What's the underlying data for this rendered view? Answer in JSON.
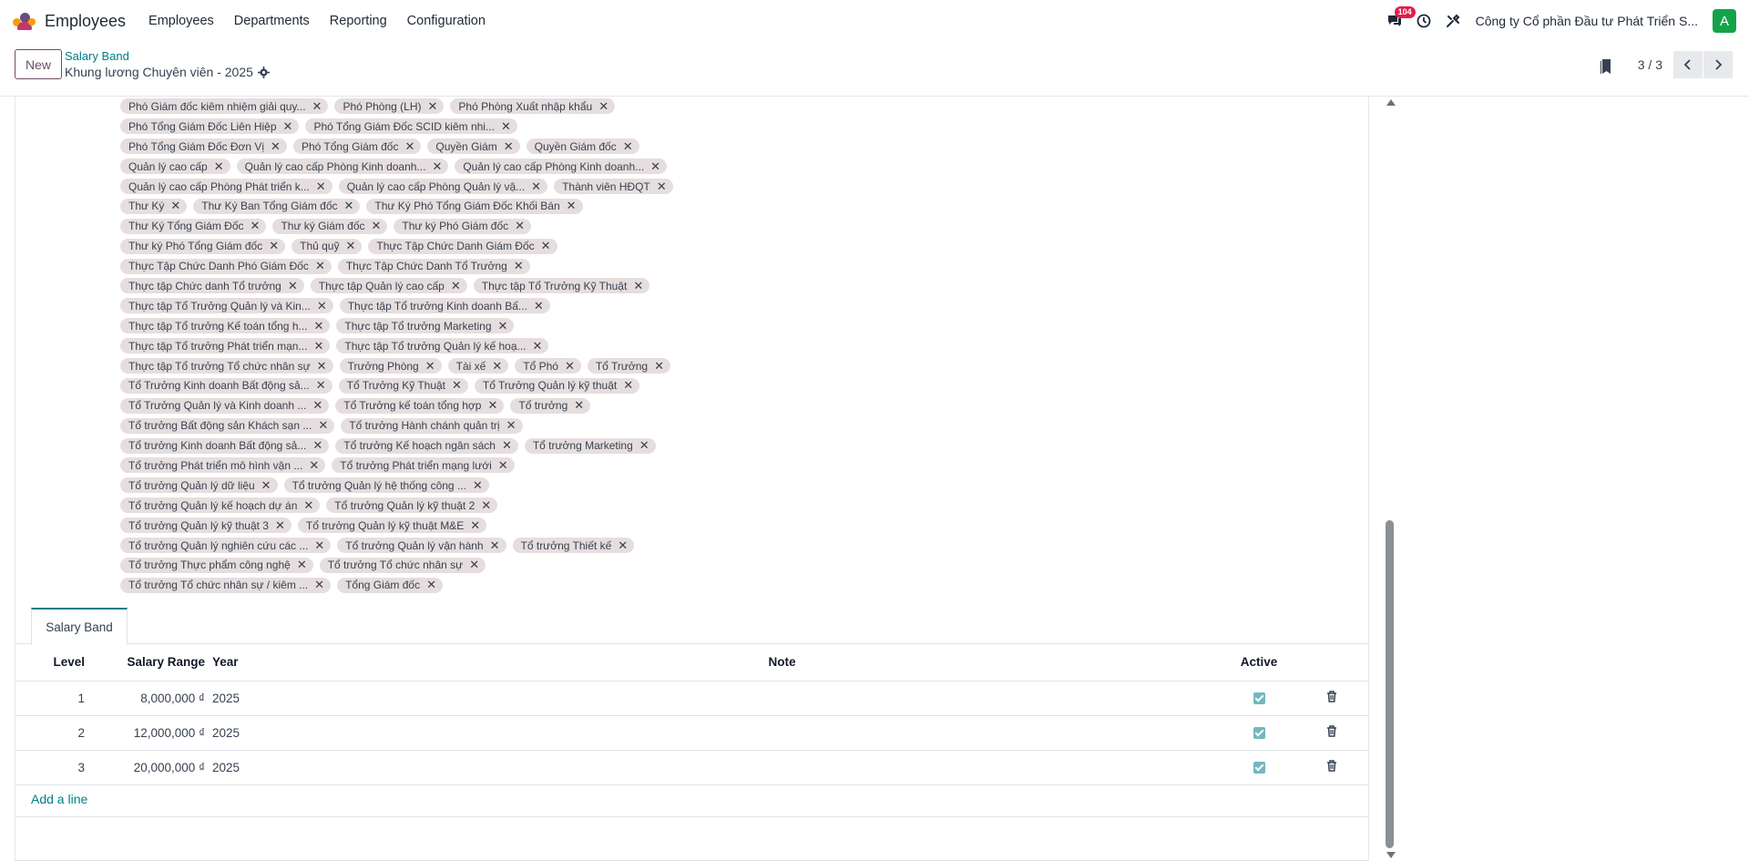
{
  "navbar": {
    "app_name": "Employees",
    "menu": [
      "Employees",
      "Departments",
      "Reporting",
      "Configuration"
    ],
    "messages_badge": "104",
    "company": "Công ty Cổ phần Đầu tư Phát Triển S...",
    "avatar_letter": "A"
  },
  "control_panel": {
    "new_label": "New",
    "breadcrumb": "Salary Band",
    "record_title": "Khung lương Chuyên viên - 2025",
    "pager": "3 / 3"
  },
  "tags": [
    [
      "Phó Giám đốc kiêm nhiệm giải quy...",
      "Phó Phòng (LH)",
      "Phó Phòng Xuất nhập khẩu"
    ],
    [
      "Phó Tổng Giám Đốc Liên Hiệp",
      "Phó Tổng Giám Đốc SCID kiêm nhi..."
    ],
    [
      "Phó Tổng Giám Đốc Đơn Vị",
      "Phó Tổng Giám đốc",
      "Quyền Giám",
      "Quyền Giám đốc"
    ],
    [
      "Quản lý cao cấp",
      "Quản lý cao cấp Phòng Kinh doanh...",
      "Quản lý cao cấp Phòng Kinh doanh..."
    ],
    [
      "Quản lý cao cấp Phòng Phát triển k...",
      "Quản lý cao cấp Phòng Quản lý vậ...",
      "Thành viên HĐQT"
    ],
    [
      "Thư Ký",
      "Thư Ký Ban Tổng Giám đốc",
      "Thư Ký Phó Tổng Giám Đốc Khối Bán"
    ],
    [
      "Thư Ký Tổng Giám Đốc",
      "Thư ký Giám đốc",
      "Thư ký Phó Giám đốc"
    ],
    [
      "Thư ký Phó Tổng Giám đốc",
      "Thủ quỹ",
      "Thực Tập Chức Danh Giám Đốc"
    ],
    [
      "Thực Tập Chức Danh Phó Giám Đốc",
      "Thực Tập Chức Danh Tổ Trưởng"
    ],
    [
      "Thực tập Chức danh Tổ trưởng",
      "Thực tập Quản lý cao cấp",
      "Thực tập Tổ Trưởng Kỹ Thuật"
    ],
    [
      "Thực tập Tổ Trưởng Quản lý và Kin...",
      "Thực tập Tổ trưởng Kinh doanh Bấ..."
    ],
    [
      "Thực tập Tổ trưởng Kế toán tổng h...",
      "Thực tập Tổ trưởng Marketing"
    ],
    [
      "Thực tập Tổ trưởng Phát triển mạn...",
      "Thực tập Tổ trưởng Quản lý kế hoạ..."
    ],
    [
      "Thực tập Tổ trưởng Tổ chức nhân sự",
      "Trưởng Phòng",
      "Tài xế",
      "Tổ Phó",
      "Tổ Trưởng"
    ],
    [
      "Tổ Trưởng Kinh doanh Bất động sả...",
      "Tổ Trưởng Kỹ Thuật",
      "Tổ Trưởng Quản lý kỹ thuật"
    ],
    [
      "Tổ Trưởng Quản lý và Kinh doanh ...",
      "Tổ Trưởng kế toán tổng hợp",
      "Tổ trưởng"
    ],
    [
      "Tổ trưởng Bất động sản Khách sạn ...",
      "Tổ trưởng Hành chánh quản trị"
    ],
    [
      "Tổ trưởng Kinh doanh Bất động sả...",
      "Tổ trưởng Kế hoạch ngân sách",
      "Tổ trưởng Marketing"
    ],
    [
      "Tổ trưởng Phát triển mô hình vận ...",
      "Tổ trưởng Phát triển mạng lưới"
    ],
    [
      "Tổ trưởng Quản lý dữ liệu",
      "Tổ trưởng Quản lý hệ thống công ..."
    ],
    [
      "Tổ trưởng Quản lý kế hoạch dự án",
      "Tổ trưởng Quản lý kỹ thuật 2"
    ],
    [
      "Tổ trưởng Quản lý kỹ thuật 3",
      "Tổ trưởng Quản lý kỹ thuật M&E"
    ],
    [
      "Tổ trưởng Quản lý nghiên cứu các ...",
      "Tổ trưởng Quản lý vận hành",
      "Tổ trưởng Thiết kế"
    ],
    [
      "Tổ trưởng Thực phẩm công nghệ",
      "Tổ trưởng Tổ chức nhân sự"
    ],
    [
      "Tổ trưởng Tổ chức nhân sự / kiêm ...",
      "Tổng Giám đốc"
    ]
  ],
  "notebook": {
    "tab_label": "Salary Band"
  },
  "table": {
    "headers": {
      "level": "Level",
      "range": "Salary Range",
      "year": "Year",
      "note": "Note",
      "active": "Active"
    },
    "rows": [
      {
        "level": "1",
        "range": "8,000,000 ₫",
        "year": "2025",
        "note": "",
        "active": true
      },
      {
        "level": "2",
        "range": "12,000,000 ₫",
        "year": "2025",
        "note": "",
        "active": true
      },
      {
        "level": "3",
        "range": "20,000,000 ₫",
        "year": "2025",
        "note": "",
        "active": true
      }
    ],
    "add_line_label": "Add a line"
  },
  "colors": {
    "accent": "#017e84",
    "brand": "#714b67",
    "tag_bg": "#e6dede"
  }
}
